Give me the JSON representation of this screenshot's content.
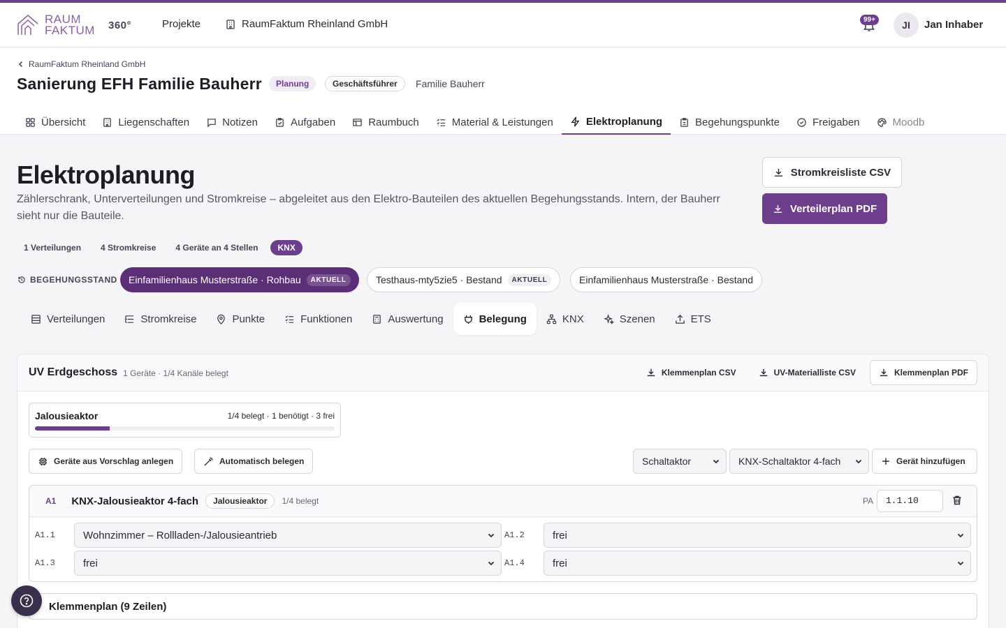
{
  "brand": {
    "logo_line1": "RAUM",
    "logo_line2": "FAKTUM",
    "badge_360": "360°"
  },
  "topnav": {
    "projects": "Projekte",
    "company": "RaumFaktum Rheinland GmbH",
    "notif_count": "99+",
    "avatar_initials": "JI",
    "user_name": "Jan Inhaber"
  },
  "breadcrumb": {
    "back": "RaumFaktum Rheinland GmbH"
  },
  "project": {
    "title": "Sanierung EFH Familie Bauherr",
    "status": "Planung",
    "role": "Geschäftsführer",
    "client": "Familie Bauherr"
  },
  "tabs": [
    {
      "label": "Übersicht",
      "icon": "grid-icon"
    },
    {
      "label": "Liegenschaften",
      "icon": "building-icon"
    },
    {
      "label": "Notizen",
      "icon": "message-icon"
    },
    {
      "label": "Aufgaben",
      "icon": "clipboard-check-icon"
    },
    {
      "label": "Raumbuch",
      "icon": "table-icon"
    },
    {
      "label": "Material & Leistungen",
      "icon": "list-check-icon"
    },
    {
      "label": "Elektroplanung",
      "icon": "bolt-icon",
      "active": true
    },
    {
      "label": "Begehungspunkte",
      "icon": "clipboard-icon"
    },
    {
      "label": "Freigaben",
      "icon": "check-circle-icon"
    },
    {
      "label": "Moodb",
      "icon": "palette-icon"
    }
  ],
  "page": {
    "title": "Elektroplanung",
    "description": "Zählerschrank, Unterverteilungen und Stromkreise – abgeleitet aus den Elektro-Bauteilen des aktuellen Begehungsstands. Intern, der Bauherr sieht nur die Bauteile.",
    "btn_csv": "Stromkreisliste CSV",
    "btn_pdf": "Verteilerplan PDF"
  },
  "stats": [
    "1 Verteilungen",
    "4 Stromkreise",
    "4 Geräte an 4 Stellen",
    "KNX"
  ],
  "begehung": {
    "label": "BEGEHUNGSSTAND",
    "items": [
      {
        "label": "Einfamilienhaus Musterstraße · Rohbau",
        "badge": "AKTUELL",
        "active": true
      },
      {
        "label": "Testhaus-mty5zie5 · Bestand",
        "badge": "AKTUELL",
        "active": false
      },
      {
        "label": "Einfamilienhaus Musterstraße · Bestand",
        "badge": "",
        "active": false
      }
    ]
  },
  "subtabs": [
    {
      "label": "Verteilungen",
      "icon": "panel-icon"
    },
    {
      "label": "Stromkreise",
      "icon": "list-tree-icon"
    },
    {
      "label": "Punkte",
      "icon": "map-pin-icon"
    },
    {
      "label": "Funktionen",
      "icon": "list-check-icon"
    },
    {
      "label": "Auswertung",
      "icon": "calculator-icon"
    },
    {
      "label": "Belegung",
      "icon": "plug-icon",
      "active": true
    },
    {
      "label": "KNX",
      "icon": "network-icon"
    },
    {
      "label": "Szenen",
      "icon": "sparkles-icon"
    },
    {
      "label": "ETS",
      "icon": "upload-icon"
    }
  ],
  "uv": {
    "title": "UV Erdgeschoss",
    "meta": "1 Geräte · 1/4 Kanäle belegt",
    "btn_klemmen_csv": "Klemmenplan CSV",
    "btn_material_csv": "UV-Materialliste CSV",
    "btn_klemmen_pdf": "Klemmenplan PDF",
    "summary": {
      "name": "Jalousieaktor",
      "info": "1/4 belegt · 1 benötigt · 3 frei",
      "fill_fraction": 0.25
    },
    "btn_vorschlag": "Geräte aus Vorschlag anlegen",
    "btn_auto": "Automatisch belegen",
    "select_type": "Schaltaktor",
    "select_model": "KNX-Schaltaktor 4-fach",
    "btn_add": "Gerät hinzufügen",
    "device": {
      "id": "A1",
      "name": "KNX-Jalousieaktor 4-fach",
      "type": "Jalousieaktor",
      "used": "1/4 belegt",
      "pa_label": "PA",
      "pa_value": "1.1.10",
      "channels": [
        {
          "id": "A1.1",
          "value": "Wohnzimmer – Rollladen-/Jalousieantrieb"
        },
        {
          "id": "A1.2",
          "value": "frei"
        },
        {
          "id": "A1.3",
          "value": "frei"
        },
        {
          "id": "A1.4",
          "value": "frei"
        }
      ]
    },
    "klemmenplan": "Klemmenplan (9 Zeilen)"
  },
  "colors": {
    "accent": "#6d3e8c",
    "accent_dark": "#5a2f75",
    "background": "#f5f4f6"
  }
}
